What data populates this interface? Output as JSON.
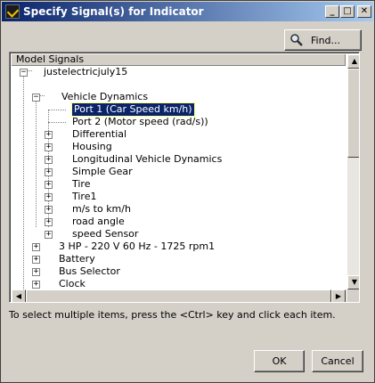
{
  "window": {
    "title": "Specify Signal(s) for Indicator",
    "minimize_glyph": "_",
    "maximize_glyph": "□",
    "close_glyph": "✕"
  },
  "find_button": {
    "label": "Find...",
    "icon": "magnifier-icon"
  },
  "tree": {
    "column_header": "Model Signals",
    "nodes": [
      {
        "label": "justelectricjuly15",
        "expander": "−",
        "selected": false
      },
      {
        "label": "Vehicle Dynamics",
        "expander": "−",
        "selected": false
      },
      {
        "label": "Port 1  (Car Speed km/h)",
        "expander": "",
        "selected": true
      },
      {
        "label": "Port 2  (Motor speed (rad/s))",
        "expander": "",
        "selected": false
      },
      {
        "label": "Differential",
        "expander": "+",
        "selected": false
      },
      {
        "label": "Housing",
        "expander": "+",
        "selected": false
      },
      {
        "label": "Longitudinal Vehicle Dynamics",
        "expander": "+",
        "selected": false
      },
      {
        "label": "Simple Gear",
        "expander": "+",
        "selected": false
      },
      {
        "label": "Tire",
        "expander": "+",
        "selected": false
      },
      {
        "label": "Tire1",
        "expander": "+",
        "selected": false
      },
      {
        "label": "m/s to km/h",
        "expander": "+",
        "selected": false
      },
      {
        "label": "road angle",
        "expander": "+",
        "selected": false
      },
      {
        "label": "speed Sensor",
        "expander": "+",
        "selected": false
      },
      {
        "label": "3 HP - 220 V 60 Hz - 1725 rpm1",
        "expander": "+",
        "selected": false
      },
      {
        "label": "Battery",
        "expander": "+",
        "selected": false
      },
      {
        "label": "Bus Selector",
        "expander": "+",
        "selected": false
      },
      {
        "label": "Clock",
        "expander": "+",
        "selected": false
      }
    ]
  },
  "hint": "To select multiple items, press the <Ctrl> key and click each item.",
  "ok_button": "OK",
  "cancel_button": "Cancel"
}
